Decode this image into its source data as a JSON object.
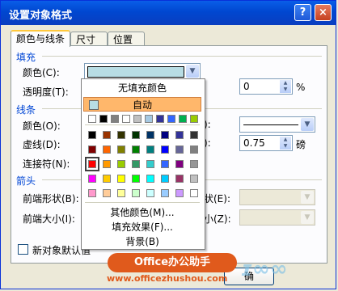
{
  "window": {
    "title": "设置对象格式",
    "help_label": "?",
    "close_label": "×"
  },
  "tabs": [
    "颜色与线条",
    "尺寸",
    "位置"
  ],
  "fill": {
    "section": "填充",
    "color_label": "颜色(C):",
    "transparency_label": "透明度(T):",
    "transparency_value": "0",
    "transparency_unit": "%"
  },
  "line": {
    "section": "线条",
    "color_label": "颜色(O):",
    "dash_label": "虚线(D):",
    "connector_label": "连接符(N):",
    "weight_value": "0.75",
    "weight_unit": "磅"
  },
  "arrows": {
    "section": "箭头",
    "begin_style_label": "前端形状(B):",
    "begin_size_label": "前端大小(I):",
    "end_style_label": "状(E):",
    "end_size_label": "小(Z):"
  },
  "default_checkbox_label": "新对象默认值",
  "ok_label": "确",
  "color_popup": {
    "no_fill": "无填充颜色",
    "automatic": "自动",
    "more_colors": "其他颜色(M)...",
    "fill_effects": "填充效果(F)...",
    "background": "背景(B)",
    "recent_colors": [
      "#ffffff",
      "#000000",
      "#808080",
      "#ffffff",
      "#c0c0c0",
      "#a6c9e2",
      "#333399",
      "#3366ff",
      "#00b050",
      "#99cc00"
    ],
    "palette": [
      [
        "#000000",
        "#993300",
        "#333300",
        "#003300",
        "#003366",
        "#000080",
        "#333399",
        "#333333"
      ],
      [
        "#800000",
        "#ff6600",
        "#808000",
        "#008000",
        "#008080",
        "#0000ff",
        "#666699",
        "#808080"
      ],
      [
        "#ff0000",
        "#ff9900",
        "#99cc00",
        "#339966",
        "#33cccc",
        "#3366ff",
        "#800080",
        "#969696"
      ],
      [
        "#ff00ff",
        "#ffcc00",
        "#ffff00",
        "#00ff00",
        "#00ffff",
        "#00ccff",
        "#993366",
        "#c0c0c0"
      ],
      [
        "#ff99cc",
        "#ffcc99",
        "#ffff99",
        "#ccffcc",
        "#ccffff",
        "#99ccff",
        "#cc99ff",
        "#ffffff"
      ]
    ],
    "selected_palette_color": "#ff0000"
  },
  "watermark": {
    "badge": "Office办公助手",
    "url": "www.officezhushou.com"
  }
}
